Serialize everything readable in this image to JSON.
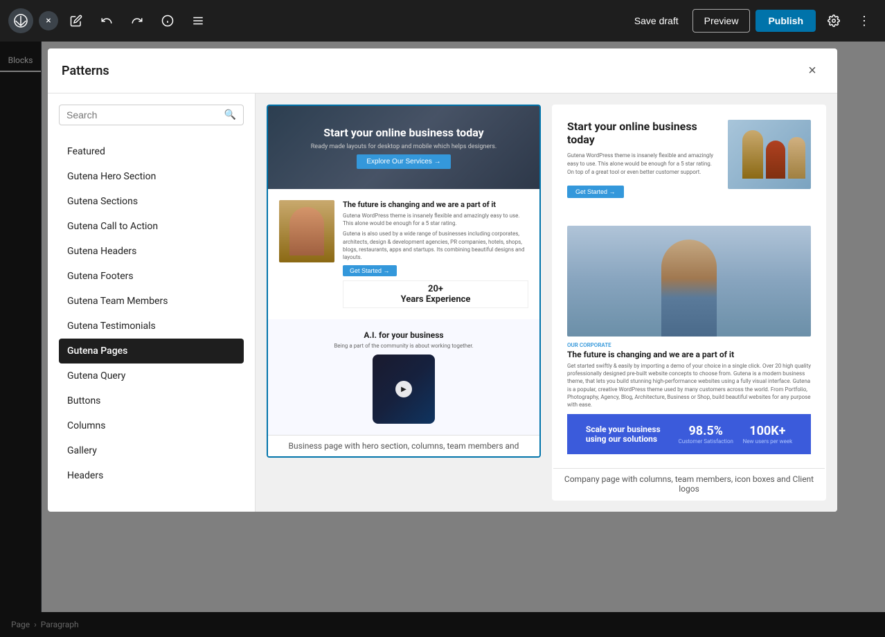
{
  "toolbar": {
    "save_draft_label": "Save draft",
    "preview_label": "Preview",
    "publish_label": "Publish"
  },
  "modal": {
    "title": "Patterns",
    "close_label": "×",
    "search_placeholder": "Search",
    "categories": [
      {
        "id": "featured",
        "label": "Featured",
        "active": false
      },
      {
        "id": "gutena-hero-section",
        "label": "Gutena Hero Section",
        "active": false
      },
      {
        "id": "gutena-sections",
        "label": "Gutena Sections",
        "active": false
      },
      {
        "id": "gutena-call-to-action",
        "label": "Gutena Call to Action",
        "active": false
      },
      {
        "id": "gutena-headers",
        "label": "Gutena Headers",
        "active": false
      },
      {
        "id": "gutena-footers",
        "label": "Gutena Footers",
        "active": false
      },
      {
        "id": "gutena-team-members",
        "label": "Gutena Team Members",
        "active": false
      },
      {
        "id": "gutena-testimonials",
        "label": "Gutena Testimonials",
        "active": false
      },
      {
        "id": "gutena-pages",
        "label": "Gutena Pages",
        "active": true
      },
      {
        "id": "gutena-query",
        "label": "Gutena Query",
        "active": false
      },
      {
        "id": "buttons",
        "label": "Buttons",
        "active": false
      },
      {
        "id": "columns",
        "label": "Columns",
        "active": false
      },
      {
        "id": "gallery",
        "label": "Gallery",
        "active": false
      },
      {
        "id": "headers",
        "label": "Headers",
        "active": false
      }
    ]
  },
  "patterns": {
    "left_card": {
      "hero_title": "Start your online business today",
      "hero_subtitle": "Ready made layouts for desktop and mobile which helps designers.",
      "hero_btn": "Explore Our Services →",
      "team_title": "The future is changing and we are a part of it",
      "team_desc1": "Gutena WordPress theme is insanely flexible and amazingly easy to use. This alone would be enough for a 5 star rating.",
      "team_desc2": "Gutena is also used by a wide range of businesses including corporates, architects, design & development agencies, PR companies, hotels, shops, blogs, restaurants, apps and startups. Its combining beautiful designs and layouts.",
      "team_btn": "Get Started →",
      "experience_num": "20+",
      "experience_label": "Years Experience",
      "ai_title": "A.I. for your business",
      "ai_subtitle": "Being a part of the community is about working together.",
      "card_label": "Business page with hero section, columns, team members and"
    },
    "right_card": {
      "hero_title": "Start your online business today",
      "hero_desc": "Gutena WordPress theme is insanely flexible and amazingly easy to use. This alone would be enough for a 5 star rating. On top of a great tool or even better customer support.",
      "hero_btn": "Get Started →",
      "person_category": "OUR CORPORATE",
      "person_title": "The future is changing and we are a part of it",
      "person_desc": "Get started swiftly & easily by importing a demo of your choice in a single click. Over 20 high quality professionally designed pre-built website concepts to choose from. Gutena is a modern business theme, that lets you build stunning high-performance websites using a fully visual interface. Gutena is a popular, creative WordPress theme used by many customers across the world. From Portfolio, Photography, Agency, Blog, Architecture, Business or Shop, build beautiful websites for any purpose with ease.",
      "stats_title": "Scale your business using our solutions",
      "stat1_number": "98.5%",
      "stat1_label": "Customer Satisfaction",
      "stat2_number": "100K+",
      "stat2_label": "New users per week",
      "card_label": "Company page with columns, team members, icon boxes and Client logos"
    }
  },
  "breadcrumb": {
    "page": "Page",
    "separator": "›",
    "paragraph": "Paragraph"
  },
  "sidebar": {
    "blocks_label": "Blocks"
  }
}
